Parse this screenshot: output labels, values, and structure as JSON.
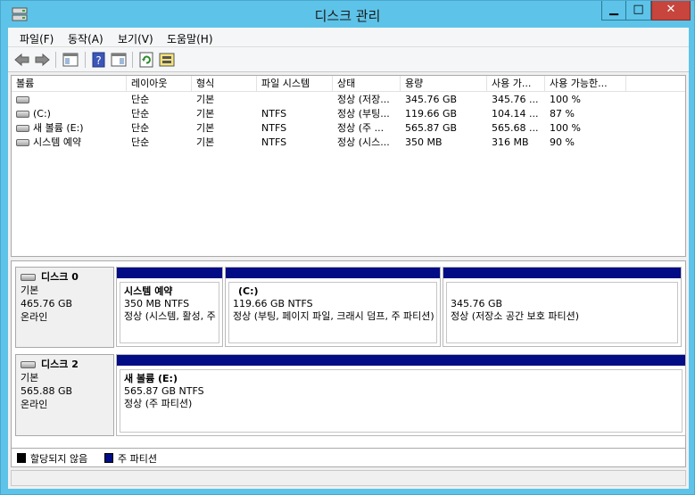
{
  "window": {
    "title": "디스크 관리",
    "min_glyph": "▁",
    "max_glyph": "□",
    "close_glyph": "✕"
  },
  "menu": [
    "파일(F)",
    "동작(A)",
    "보기(V)",
    "도움말(H)"
  ],
  "list": {
    "columns": [
      "볼륨",
      "레이아웃",
      "형식",
      "파일 시스템",
      "상태",
      "용량",
      "사용 가...",
      "사용 가능한..."
    ],
    "rows": [
      [
        "",
        "단순",
        "기본",
        "",
        "정상 (저장...",
        "345.76 GB",
        "345.76 ...",
        "100 %"
      ],
      [
        "(C:)",
        "단순",
        "기본",
        "NTFS",
        "정상 (부팅...",
        "119.66 GB",
        "104.14 ...",
        "87 %"
      ],
      [
        "새 볼륨 (E:)",
        "단순",
        "기본",
        "NTFS",
        "정상 (주 ...",
        "565.87 GB",
        "565.68 ...",
        "100 %"
      ],
      [
        "시스템 예약",
        "단순",
        "기본",
        "NTFS",
        "정상 (시스...",
        "350 MB",
        "316 MB",
        "90 %"
      ]
    ]
  },
  "disks": [
    {
      "name": "디스크 0",
      "type": "기본",
      "size": "465.76 GB",
      "status": "온라인",
      "partitions": [
        {
          "name": "시스템 예약",
          "detail": "350 MB NTFS",
          "status": "정상 (시스템, 활성, 주 파티션)"
        },
        {
          "name": "(C:)",
          "detail": "119.66 GB NTFS",
          "status": "정상 (부팅, 페이지 파일, 크래시 덤프, 주 파티션)"
        },
        {
          "name": "",
          "detail": "345.76 GB",
          "status": "정상 (저장소 공간 보호 파티션)"
        }
      ]
    },
    {
      "name": "디스크 2",
      "type": "기본",
      "size": "565.88 GB",
      "status": "온라인",
      "partitions": [
        {
          "name": "새 볼륨  (E:)",
          "detail": "565.87 GB NTFS",
          "status": "정상 (주 파티션)"
        }
      ]
    }
  ],
  "legend": [
    {
      "label": "할당되지 않음",
      "color": "#000000"
    },
    {
      "label": "주 파티션",
      "color": "#020c85"
    }
  ],
  "colors": {
    "title_bar": "#5ec3e8",
    "partition_bar": "#020c85",
    "close_button": "#c7453c"
  }
}
